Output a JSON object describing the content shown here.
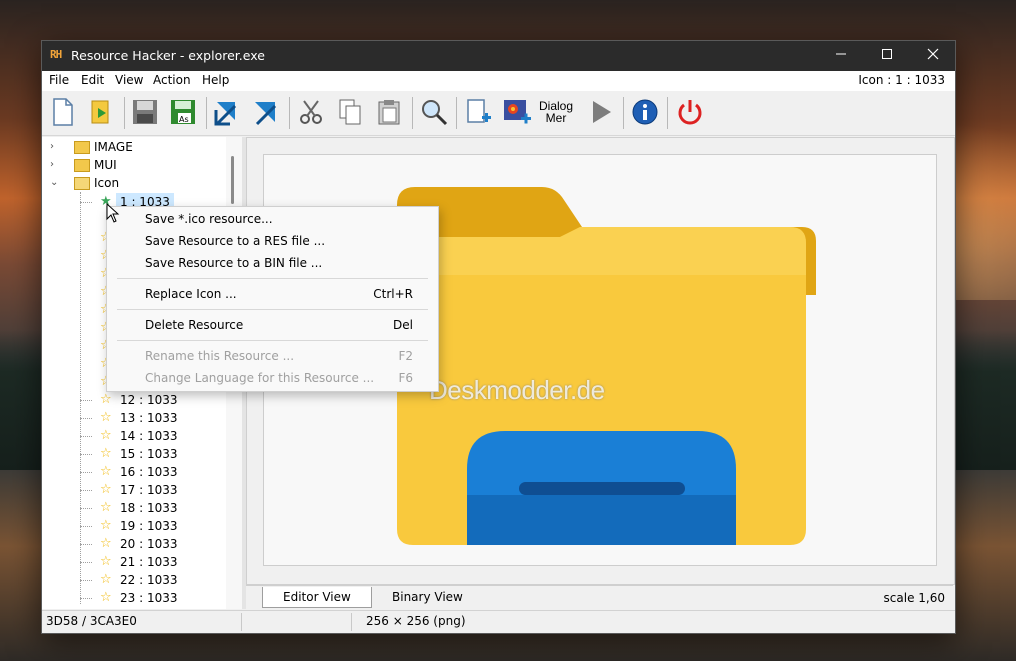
{
  "window": {
    "title": "Resource Hacker - explorer.exe",
    "logo": "RH",
    "controls": {
      "minimize": "—",
      "maximize": "☐",
      "close": "✕"
    }
  },
  "menubar": {
    "items": [
      "File",
      "Edit",
      "View",
      "Action",
      "Help"
    ],
    "right_info": "Icon : 1 : 1033"
  },
  "toolbar": {
    "dialog_label_line1": "Dialog",
    "dialog_label_line2": "Mer",
    "icons": [
      "new-file-icon",
      "open-file-icon",
      "save-icon",
      "save-as-icon",
      "compile-icon",
      "export-icon",
      "cut-icon",
      "copy-icon",
      "paste-icon",
      "find-icon",
      "add-resource-icon",
      "add-image-icon",
      "dialog-merger-icon",
      "run-icon",
      "info-icon",
      "power-icon"
    ]
  },
  "tree": {
    "groups": [
      {
        "label": "IMAGE",
        "expanded": false
      },
      {
        "label": "MUI",
        "expanded": false
      },
      {
        "label": "Icon",
        "expanded": true
      }
    ],
    "selected": "1 : 1033",
    "items": [
      "12 : 1033",
      "13 : 1033",
      "14 : 1033",
      "15 : 1033",
      "16 : 1033",
      "17 : 1033",
      "18 : 1033",
      "19 : 1033",
      "20 : 1033",
      "21 : 1033",
      "22 : 1033",
      "23 : 1033"
    ]
  },
  "context_menu": {
    "items": [
      {
        "label": "Save *.ico resource...",
        "shortcut": "",
        "enabled": true
      },
      {
        "label": "Save Resource to a RES file ...",
        "shortcut": "",
        "enabled": true
      },
      {
        "label": "Save Resource to a BIN file ...",
        "shortcut": "",
        "enabled": true
      },
      {
        "label": "Replace Icon ...",
        "shortcut": "Ctrl+R",
        "enabled": true
      },
      {
        "label": "Delete Resource",
        "shortcut": "Del",
        "enabled": true
      },
      {
        "label": "Rename this Resource ...",
        "shortcut": "F2",
        "enabled": false
      },
      {
        "label": "Change Language for this Resource ...",
        "shortcut": "F6",
        "enabled": false
      }
    ]
  },
  "editor": {
    "watermark": "Deskmodder.de",
    "tabs": [
      "Editor View",
      "Binary View"
    ],
    "active_tab": "Editor View",
    "scale": "scale 1,60"
  },
  "statusbar": {
    "offset": "3D58 / 3CA3E0",
    "image_info": "256 × 256 (png)"
  },
  "colors": {
    "folder_yellow": "#F9C93D",
    "folder_dark": "#E0A514",
    "blue_tab": "#1A7FD6",
    "blue_tab_dark": "#0F5BA6",
    "titlebar": "#2B2B2B"
  }
}
